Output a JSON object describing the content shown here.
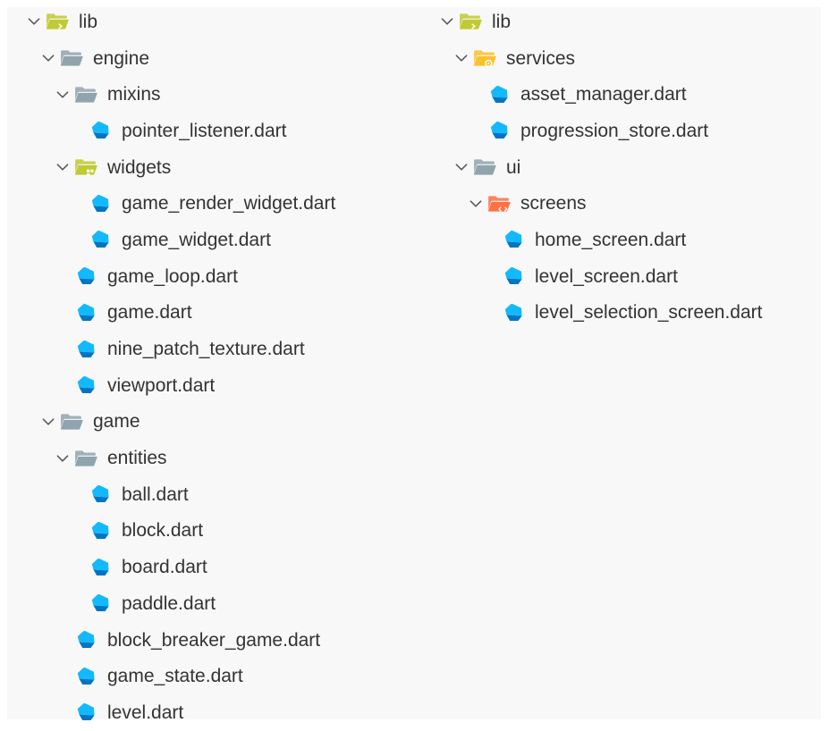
{
  "colors": {
    "folder_gray": "#90a4ae",
    "folder_lib": "#c0ca33",
    "folder_services": "#fbc02d",
    "folder_widgets": "#c0ca33",
    "folder_screens": "#ff7043",
    "dart_dark": "#0175c2",
    "dart_light": "#13b9fd",
    "text": "#333333",
    "chevron": "#5a5a5a"
  },
  "left_tree": [
    {
      "name": "lib",
      "type": "folder",
      "icon": "folder-lib-icon",
      "depth": 0,
      "expanded": true
    },
    {
      "name": "engine",
      "type": "folder",
      "icon": "folder-gray-icon",
      "depth": 1,
      "expanded": true
    },
    {
      "name": "mixins",
      "type": "folder",
      "icon": "folder-gray-icon",
      "depth": 2,
      "expanded": true
    },
    {
      "name": "pointer_listener.dart",
      "type": "file",
      "icon": "dart-file-icon",
      "depth": 3
    },
    {
      "name": "widgets",
      "type": "folder",
      "icon": "folder-widgets-icon",
      "depth": 2,
      "expanded": true
    },
    {
      "name": "game_render_widget.dart",
      "type": "file",
      "icon": "dart-file-icon",
      "depth": 3
    },
    {
      "name": "game_widget.dart",
      "type": "file",
      "icon": "dart-file-icon",
      "depth": 3
    },
    {
      "name": "game_loop.dart",
      "type": "file",
      "icon": "dart-file-icon",
      "depth": 2
    },
    {
      "name": "game.dart",
      "type": "file",
      "icon": "dart-file-icon",
      "depth": 2
    },
    {
      "name": "nine_patch_texture.dart",
      "type": "file",
      "icon": "dart-file-icon",
      "depth": 2
    },
    {
      "name": "viewport.dart",
      "type": "file",
      "icon": "dart-file-icon",
      "depth": 2
    },
    {
      "name": "game",
      "type": "folder",
      "icon": "folder-gray-icon",
      "depth": 1,
      "expanded": true
    },
    {
      "name": "entities",
      "type": "folder",
      "icon": "folder-gray-icon",
      "depth": 2,
      "expanded": true
    },
    {
      "name": "ball.dart",
      "type": "file",
      "icon": "dart-file-icon",
      "depth": 3
    },
    {
      "name": "block.dart",
      "type": "file",
      "icon": "dart-file-icon",
      "depth": 3
    },
    {
      "name": "board.dart",
      "type": "file",
      "icon": "dart-file-icon",
      "depth": 3
    },
    {
      "name": "paddle.dart",
      "type": "file",
      "icon": "dart-file-icon",
      "depth": 3
    },
    {
      "name": "block_breaker_game.dart",
      "type": "file",
      "icon": "dart-file-icon",
      "depth": 2
    },
    {
      "name": "game_state.dart",
      "type": "file",
      "icon": "dart-file-icon",
      "depth": 2
    },
    {
      "name": "level.dart",
      "type": "file",
      "icon": "dart-file-icon",
      "depth": 2
    }
  ],
  "right_tree": [
    {
      "name": "lib",
      "type": "folder",
      "icon": "folder-lib-icon",
      "depth": 0,
      "expanded": true
    },
    {
      "name": "services",
      "type": "folder",
      "icon": "folder-services-icon",
      "depth": 1,
      "expanded": true
    },
    {
      "name": "asset_manager.dart",
      "type": "file",
      "icon": "dart-file-icon",
      "depth": 2
    },
    {
      "name": "progression_store.dart",
      "type": "file",
      "icon": "dart-file-icon",
      "depth": 2
    },
    {
      "name": "ui",
      "type": "folder",
      "icon": "folder-gray-icon",
      "depth": 1,
      "expanded": true
    },
    {
      "name": "screens",
      "type": "folder",
      "icon": "folder-screens-icon",
      "depth": 2,
      "expanded": true
    },
    {
      "name": "home_screen.dart",
      "type": "file",
      "icon": "dart-file-icon",
      "depth": 3
    },
    {
      "name": "level_screen.dart",
      "type": "file",
      "icon": "dart-file-icon",
      "depth": 3
    },
    {
      "name": "level_selection_screen.dart",
      "type": "file",
      "icon": "dart-file-icon",
      "depth": 3
    }
  ]
}
